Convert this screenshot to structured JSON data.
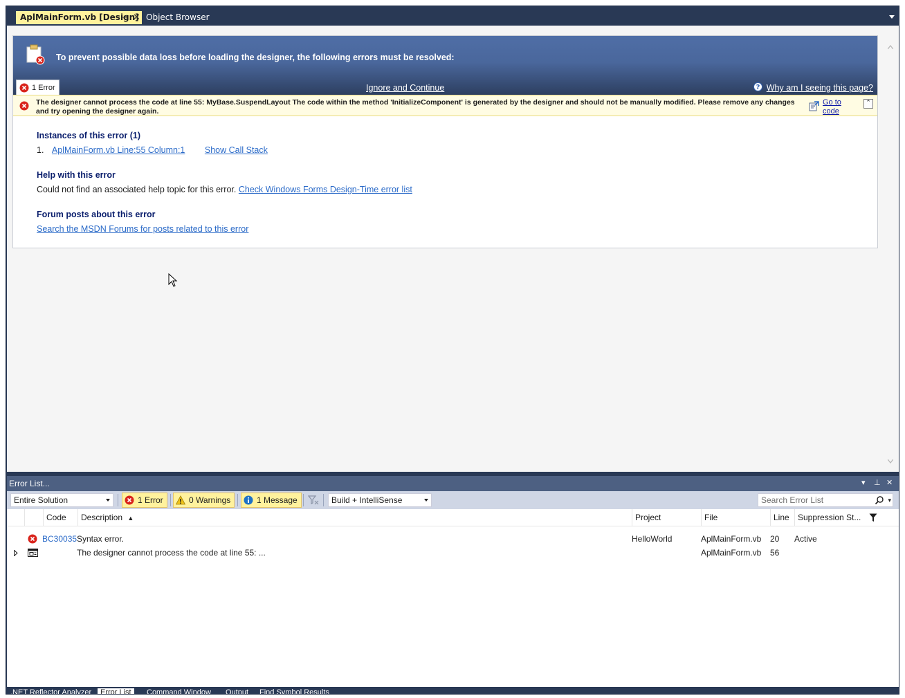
{
  "doc_tabs": {
    "active": "AplMainForm.vb [Design]",
    "pin_glyph": "⊣",
    "close_glyph": "✕",
    "other": "Object Browser"
  },
  "designer": {
    "header_title": "To prevent possible data loss before loading the designer, the following errors must be resolved:",
    "error_tab_label": "1 Error",
    "ignore_link": "Ignore and Continue",
    "why_link": "Why am I seeing this page?",
    "error_message": "The designer cannot process the code at line 55: MyBase.SuspendLayout The code within the method 'InitializeComponent' is generated by the designer and should not be manually modified. Please remove any changes and try opening the designer again.",
    "goto_code": "Go to code",
    "instances_title": "Instances of this error (1)",
    "instance_number": "1.",
    "instance_link": "AplMainForm.vb Line:55 Column:1",
    "call_stack_link": "Show Call Stack",
    "help_title": "Help with this error",
    "help_text": "Could not find an associated help topic for this error.",
    "help_link": "Check Windows Forms Design-Time error list",
    "forum_title": "Forum posts about this error",
    "forum_link": "Search the MSDN Forums for posts related to this error"
  },
  "error_list": {
    "title": "Error List...",
    "scope": "Entire Solution",
    "errors_btn": "1 Error",
    "warnings_btn": "0 Warnings",
    "messages_btn": "1 Message",
    "build_filter": "Build + IntelliSense",
    "search_placeholder": "Search Error List",
    "columns": {
      "code": "Code",
      "description": "Description",
      "project": "Project",
      "file": "File",
      "line": "Line",
      "suppression": "Suppression St..."
    },
    "rows": [
      {
        "code": "BC30035",
        "description": "Syntax error.",
        "project": "HelloWorld",
        "file": "AplMainForm.vb",
        "line": "20",
        "suppression": "Active",
        "icon": "error-icon"
      },
      {
        "code": "",
        "description": "The designer cannot process the code at line 55:  ...",
        "project": "",
        "file": "AplMainForm.vb",
        "line": "56",
        "suppression": "",
        "icon": "designer-icon"
      }
    ]
  },
  "bottom_tabs": [
    ".NET Reflector Analyzer",
    "Error List",
    "Command Window",
    "Output",
    "Find Symbol Results"
  ],
  "colors": {
    "frame": "#293955",
    "active_tab": "#fff29d",
    "header_top": "#4f6ea6",
    "error_bar": "#fffce3",
    "link": "#2a6ac8",
    "heading": "#0b1f6d"
  }
}
